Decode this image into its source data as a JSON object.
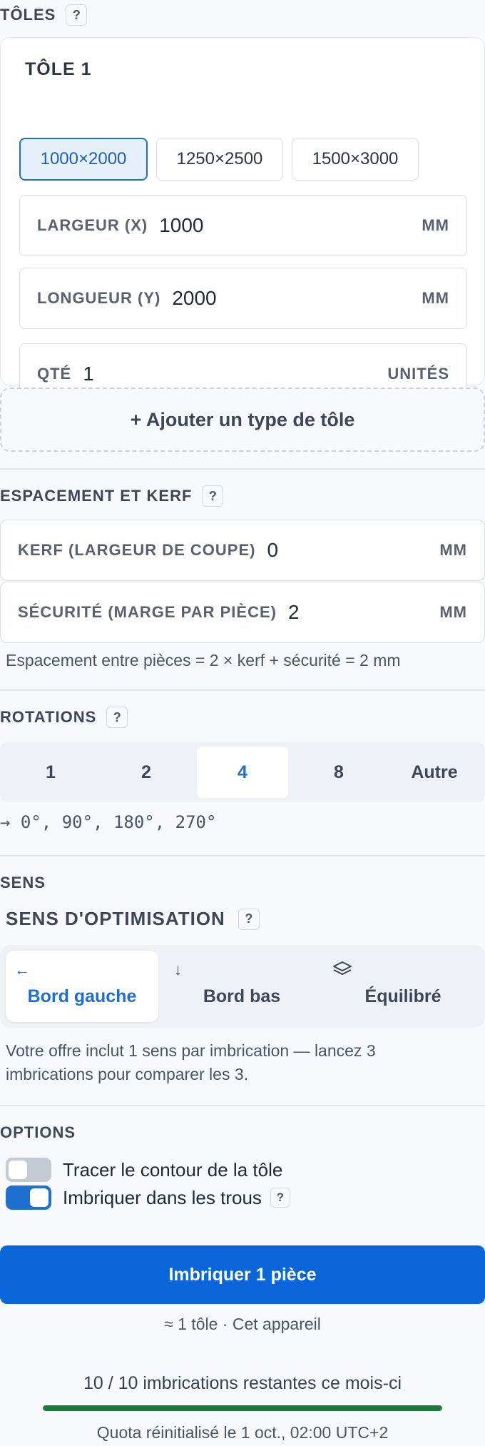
{
  "sheets": {
    "title": "TÔLES",
    "help": "?",
    "sheet_title": "TÔLE 1",
    "presets": [
      "1000×2000",
      "1250×2500",
      "1500×3000"
    ],
    "width_label": "LARGEUR (X)",
    "width_value": "1000",
    "length_label": "LONGUEUR (Y)",
    "length_value": "2000",
    "qty_label": "QTÉ",
    "qty_value": "1",
    "unit_mm": "MM",
    "unit_units": "UNITÉS",
    "add_sheet": "+ Ajouter un type de tôle"
  },
  "spacing": {
    "title": "ESPACEMENT ET KERF",
    "help": "?",
    "kerf_label": "KERF (LARGEUR DE COUPE)",
    "kerf_value": "0",
    "safety_label": "SÉCURITÉ (MARGE PAR PIÈCE)",
    "safety_value": "2",
    "unit": "MM",
    "note": "Espacement entre pièces = 2 × kerf + sécurité = 2 mm"
  },
  "rotations": {
    "title": "ROTATIONS",
    "help": "?",
    "options": [
      "1",
      "2",
      "4",
      "8",
      "Autre"
    ],
    "selected": "4",
    "angles": "→ 0°, 90°, 180°, 270°"
  },
  "direction": {
    "title": "SENS",
    "subtitle": "SENS D'OPTIMISATION",
    "help": "?",
    "options": [
      {
        "icon": "arrow-left-icon",
        "glyph": "←",
        "label": "Bord gauche"
      },
      {
        "icon": "arrow-down-icon",
        "glyph": "↓",
        "label": "Bord bas"
      },
      {
        "icon": "layers-icon",
        "glyph": "",
        "label": "Équilibré"
      }
    ],
    "selected": "Bord gauche",
    "note": "Votre offre inclut 1 sens par imbrication — lancez 3 imbrications pour comparer les 3."
  },
  "options": {
    "title": "OPTIONS",
    "trace_label": "Tracer le contour de la tôle",
    "trace_on": false,
    "holes_label": "Imbriquer dans les trous",
    "holes_on": true,
    "help": "?"
  },
  "action": {
    "button": "Imbriquer 1 pièce",
    "estimate": "≈ 1 tôle · Cet appareil"
  },
  "quota": {
    "text": "10 / 10 imbrications restantes ce mois-ci",
    "remaining_fraction": 1.0,
    "reset": "Quota réinitialisé le 1 oct., 02:00 UTC+2"
  },
  "colors": {
    "accent": "#1f6fd1",
    "button": "#0a66d8",
    "progress": "#1e7a3a",
    "toggle_off": "#c4cad3"
  }
}
